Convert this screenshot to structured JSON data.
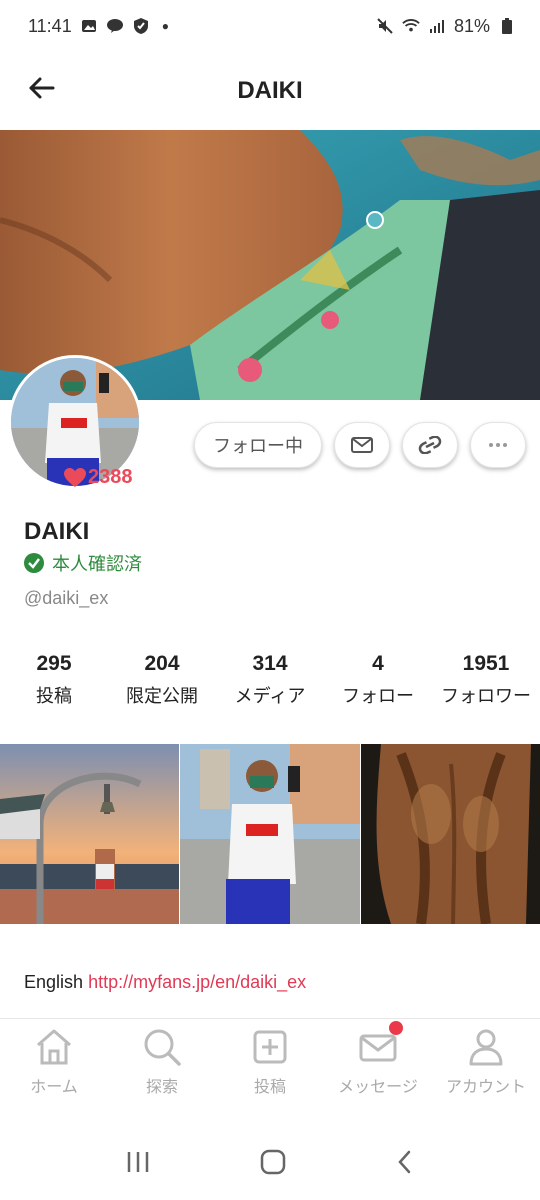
{
  "status_bar": {
    "time": "11:41",
    "battery": "81%"
  },
  "header": {
    "title": "DAIKI"
  },
  "profile": {
    "likes": "2388",
    "name": "DAIKI",
    "verified_label": "本人確認済",
    "handle": "@daiki_ex"
  },
  "actions": {
    "follow_label": "フォロー中"
  },
  "stats": [
    {
      "value": "295",
      "label": "投稿"
    },
    {
      "value": "204",
      "label": "限定公開"
    },
    {
      "value": "314",
      "label": "メディア"
    },
    {
      "value": "4",
      "label": "フォロー"
    },
    {
      "value": "1951",
      "label": "フォロワー"
    }
  ],
  "bio": {
    "prefix": "English",
    "link": "http://myfans.jp/en/daiki_ex"
  },
  "bottom_nav": [
    {
      "label": "ホーム",
      "icon": "home-icon"
    },
    {
      "label": "探索",
      "icon": "search-icon"
    },
    {
      "label": "投稿",
      "icon": "plus-square-icon"
    },
    {
      "label": "メッセージ",
      "icon": "mail-icon"
    },
    {
      "label": "アカウント",
      "icon": "person-icon"
    }
  ],
  "colors": {
    "accent": "#ea4a5a",
    "verified": "#2e8b3e",
    "link": "#e03a55"
  }
}
